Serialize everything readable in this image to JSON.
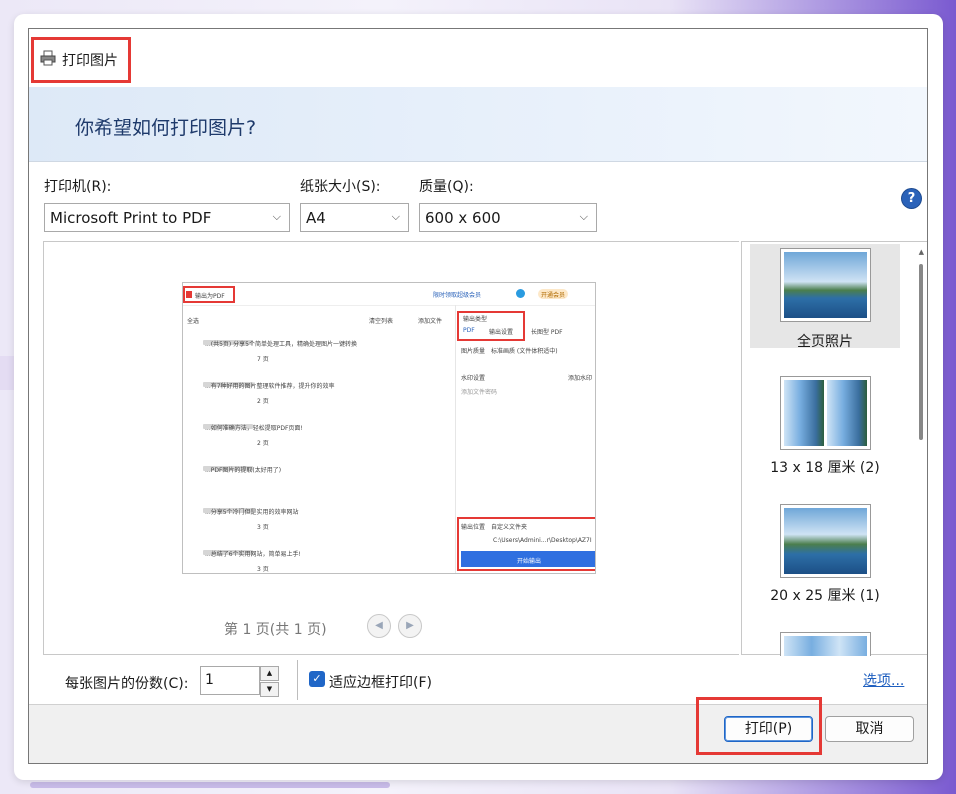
{
  "dialog": {
    "title": "打印图片",
    "question": "你希望如何打印图片?"
  },
  "controls": {
    "printer_label": "打印机(R):",
    "printer_value": "Microsoft Print to PDF",
    "paper_label": "纸张大小(S):",
    "paper_value": "A4",
    "quality_label": "质量(Q):",
    "quality_value": "600 x 600",
    "help": "?"
  },
  "preview": {
    "pager": "第 1 页(共 1 页)",
    "mini": {
      "app_title": "输出为PDF",
      "banner": "限时领取超级会员",
      "vip": "开通会员",
      "list_title": "全选",
      "clear_list": "清空列表",
      "add_file": "添加文件",
      "rows": [
        {
          "name": "...(共5页) 分享5个简单处理工具，精确处理图片一键转换",
          "pages": "7 页"
        },
        {
          "name": "...有7种好用的图片整理软件推荐，提升你的效率",
          "pages": "2 页"
        },
        {
          "name": "...如何准确方法，轻松提取PDF页面!",
          "pages": "2 页"
        },
        {
          "name": "...PDF图片的提取(太好用了)",
          "pages": ""
        },
        {
          "name": "...分享5个冷门但是实用的效率网站",
          "pages": "3 页"
        },
        {
          "name": "...总结了6个实用网站，简单易上手!",
          "pages": "3 页"
        }
      ],
      "output_type": "输出类型",
      "radio_pdf": "PDF",
      "output_settings": "输出设置",
      "radio_long": "长图型 PDF",
      "page_size": "图片质量",
      "page_size_val": "标准画质 (文件体积适中)",
      "watermark": "水印设置",
      "add_watermark": "添加水印",
      "encrypt": "添加文件密码",
      "output_dir_label": "输出位置",
      "output_dir": "自定义文件夹",
      "output_path": "C:\\Users\\Admini...r\\Desktop\\AZ7I",
      "start_btn": "开始输出"
    }
  },
  "sidebar": {
    "items": [
      {
        "label": "全页照片",
        "selected": true
      },
      {
        "label": "13 x 18 厘米 (2)",
        "selected": false
      },
      {
        "label": "20 x 25 厘米 (1)",
        "selected": false
      }
    ]
  },
  "copies": {
    "label": "每张图片的份数(C):",
    "value": "1",
    "fit_label": "适应边框打印(F)",
    "fit_checked": true,
    "options_link": "选项..."
  },
  "footer": {
    "print_label": "打印(P)",
    "cancel_label": "取消"
  },
  "colors": {
    "accent": "#1f66c7",
    "highlight_border": "#e53935",
    "header_bg": "#dde9f7"
  }
}
